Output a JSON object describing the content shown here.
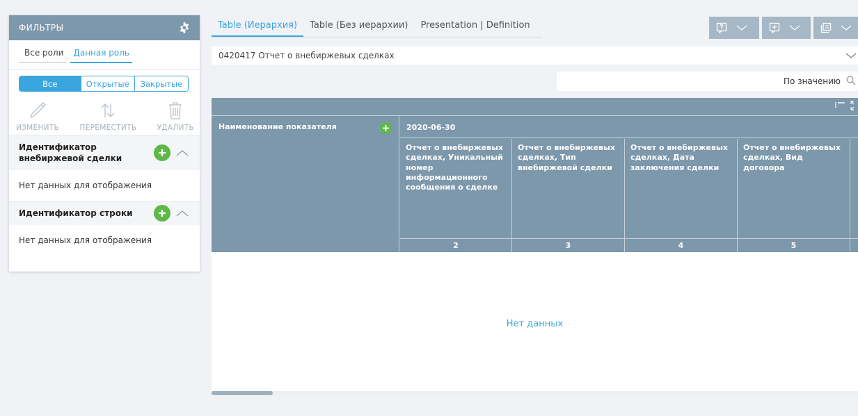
{
  "filters": {
    "title": "ФИЛЬТРЫ",
    "role_tabs": [
      "Все роли",
      "Данная роль"
    ],
    "segments": [
      "Все",
      "Открытые",
      "Закрытые"
    ],
    "actions": [
      "ИЗМЕНИТЬ",
      "ПЕРЕМЕСТИТЬ",
      "УДАЛИТЬ"
    ],
    "sections": [
      {
        "title": "Идентификатор внебиржевой сделки",
        "empty_text": "Нет данных для отображения"
      },
      {
        "title": "Идентификатор строки",
        "empty_text": "Нет данных для отображения"
      }
    ]
  },
  "main": {
    "tabs": [
      "Table (Иерархия)",
      "Table (Без иерархии)",
      "Presentation | Definition"
    ],
    "select_value": "0420417 Отчет о внебиржевых сделках",
    "search_placeholder": "По значению",
    "table": {
      "name_header": "Наименование показателя",
      "date": "2020-06-30",
      "columns": [
        "Отчет о внебиржевых сделках, Уникальный номер информационного сообщения о сделке",
        "Отчет о внебиржевых сделках, Тип внебиржевой сделки",
        "Отчет о внебиржевых сделках, Дата заключения сделки",
        "Отчет о внебиржевых сделках, Вид договора"
      ],
      "numbers": [
        "2",
        "3",
        "4",
        "5"
      ],
      "empty": "Нет данных"
    }
  },
  "icons": {
    "gear": "gear-icon",
    "edit": "pencil-icon",
    "move": "arrows-updown-icon",
    "delete": "trash-icon",
    "toolbar": [
      "comment-question-icon",
      "comment-add-icon",
      "copy-icon"
    ]
  },
  "colors": {
    "accent": "#3aa6e0",
    "header_bg": "#7d97ab",
    "add_green": "#5db848"
  }
}
